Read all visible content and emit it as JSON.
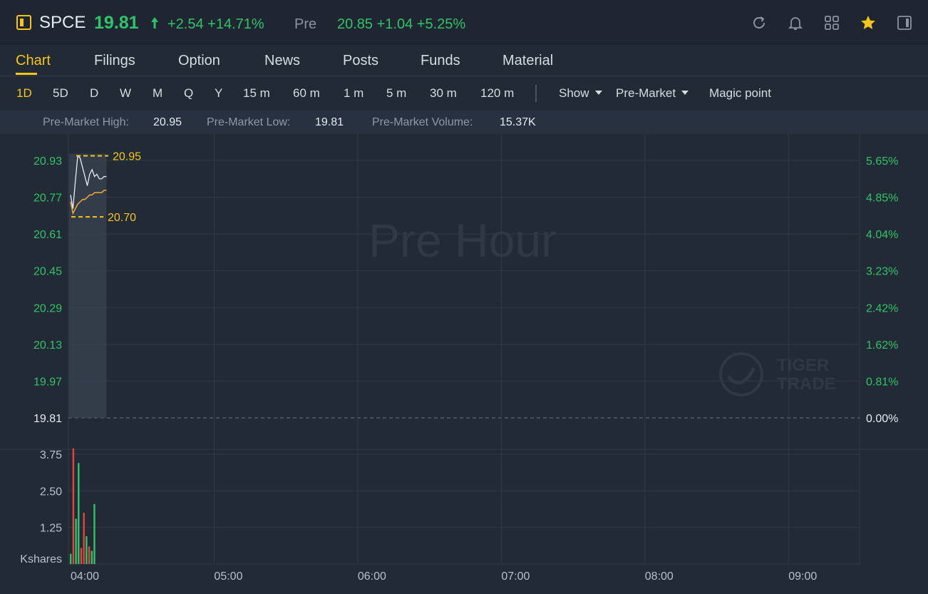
{
  "header": {
    "symbol": "SPCE",
    "price": "19.81",
    "change": "+2.54 +14.71%",
    "pre_label": "Pre",
    "pre_value": "20.85 +1.04 +5.25%",
    "icons": [
      "refresh-icon",
      "bell-icon",
      "grid-icon",
      "star-icon",
      "panel-icon"
    ],
    "colors": {
      "up": "#2fc36a",
      "accent": "#f5c518"
    }
  },
  "tabs": [
    {
      "label": "Chart",
      "active": true
    },
    {
      "label": "Filings"
    },
    {
      "label": "Option"
    },
    {
      "label": "News"
    },
    {
      "label": "Posts"
    },
    {
      "label": "Funds"
    },
    {
      "label": "Material"
    }
  ],
  "toolbar": {
    "periods": [
      "1D",
      "5D",
      "D",
      "W",
      "M",
      "Q",
      "Y",
      "15 m",
      "60 m",
      "1 m",
      "5 m",
      "30 m",
      "120 m"
    ],
    "active_period": "1D",
    "show_label": "Show",
    "session_label": "Pre-Market",
    "magic_label": "Magic point"
  },
  "infobar": {
    "high_label": "Pre-Market High:",
    "high_value": "20.95",
    "low_label": "Pre-Market Low:",
    "low_value": "19.81",
    "volume_label": "Pre-Market Volume:",
    "volume_value": "15.37K"
  },
  "chart_data": {
    "type": "line",
    "watermark": "Pre Hour",
    "brand_watermark": [
      "TIGER",
      "TRADE"
    ],
    "x_ticks": [
      "04:00",
      "05:00",
      "06:00",
      "07:00",
      "08:00",
      "09:00"
    ],
    "y_ticks": [
      "20.93",
      "20.77",
      "20.61",
      "20.45",
      "20.29",
      "20.13",
      "19.97",
      "19.81"
    ],
    "y_pct_ticks": [
      "5.65%",
      "4.85%",
      "4.04%",
      "3.23%",
      "2.42%",
      "1.62%",
      "0.81%",
      "0.00%"
    ],
    "y_range": [
      19.81,
      20.93
    ],
    "volume_ticks": [
      "3.75",
      "2.50",
      "1.25"
    ],
    "volume_unit": "Kshares",
    "volume_range": [
      0,
      3.75
    ],
    "high_marker": "20.95",
    "low_marker": "20.70",
    "price_series": {
      "x": [
        0,
        2,
        4,
        6,
        8,
        10,
        12,
        14,
        16,
        18,
        20,
        22,
        24,
        26,
        28,
        30
      ],
      "y": [
        20.78,
        20.72,
        20.84,
        20.95,
        20.94,
        20.9,
        20.86,
        20.82,
        20.87,
        20.89,
        20.86,
        20.87,
        20.85,
        20.85,
        20.86,
        20.86
      ]
    },
    "avg_series": {
      "x": [
        0,
        2,
        4,
        6,
        8,
        10,
        12,
        14,
        16,
        18,
        20,
        22,
        24,
        26,
        28,
        30
      ],
      "y": [
        20.75,
        20.7,
        20.72,
        20.74,
        20.75,
        20.76,
        20.76,
        20.77,
        20.78,
        20.78,
        20.79,
        20.79,
        20.79,
        20.79,
        20.8,
        20.8
      ]
    },
    "volume": [
      {
        "min": 0,
        "v": 0.35,
        "up": true
      },
      {
        "min": 1,
        "v": 3.95,
        "up": false
      },
      {
        "min": 2,
        "v": 1.55,
        "up": true
      },
      {
        "min": 3,
        "v": 3.45,
        "up": true
      },
      {
        "min": 4,
        "v": 0.55,
        "up": false
      },
      {
        "min": 5,
        "v": 1.75,
        "up": false
      },
      {
        "min": 6,
        "v": 0.95,
        "up": true
      },
      {
        "min": 7,
        "v": 0.6,
        "up": false
      },
      {
        "min": 8,
        "v": 0.45,
        "up": true
      },
      {
        "min": 9,
        "v": 2.05,
        "up": true
      }
    ],
    "colors": {
      "up": "#2fc36a",
      "down": "#e2463f",
      "price_line": "#e6ebf1",
      "avg_line": "#f0a93a",
      "marker": "#f5c518"
    }
  }
}
